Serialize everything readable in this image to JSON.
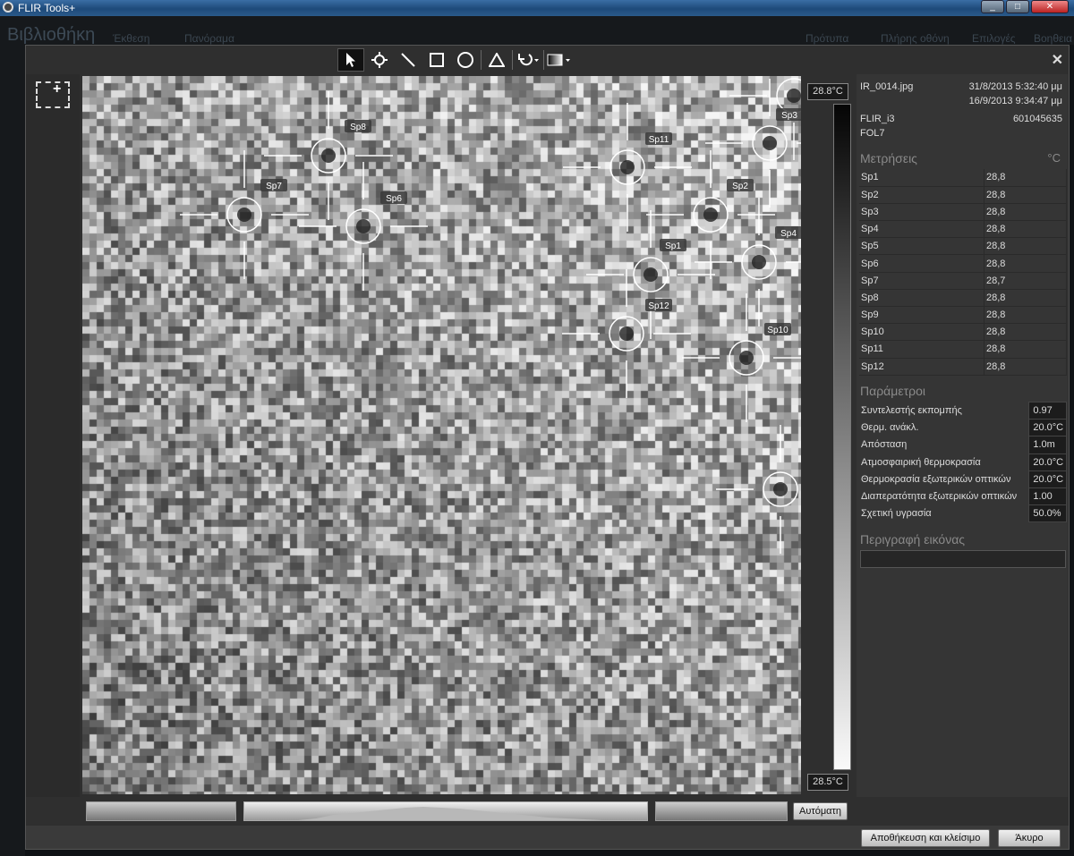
{
  "window": {
    "title": "FLIR Tools+"
  },
  "app_nav": {
    "library": "Βιβλιοθήκη",
    "items": [
      "Έκθεση",
      "Πανόραμα"
    ],
    "right_items": [
      "Πρότυπα",
      "Πλήρης οθόνη",
      "Επιλογές",
      "Βοηθεια"
    ]
  },
  "toolbar": {
    "tools": [
      {
        "name": "select-tool",
        "icon": "arrow-pointer-icon"
      },
      {
        "name": "spot-tool",
        "icon": "crosshair-icon"
      },
      {
        "name": "line-tool",
        "icon": "line-icon"
      },
      {
        "name": "box-tool",
        "icon": "square-icon"
      },
      {
        "name": "circle-tool",
        "icon": "circle-icon"
      },
      {
        "name": "delta-tool",
        "icon": "delta-icon"
      },
      {
        "name": "rotate-tool",
        "icon": "rotate-icon"
      },
      {
        "name": "palette-tool",
        "icon": "palette-icon"
      }
    ]
  },
  "spots": [
    {
      "label": "Sp1"
    },
    {
      "label": "Sp2"
    },
    {
      "label": "Sp3"
    },
    {
      "label": "Sp4"
    },
    {
      "label": "Sp5"
    },
    {
      "label": "Sp6"
    },
    {
      "label": "Sp7"
    },
    {
      "label": "Sp8"
    },
    {
      "label": "Sp9"
    },
    {
      "label": "Sp10"
    },
    {
      "label": "Sp11"
    },
    {
      "label": "Sp12"
    }
  ],
  "scale": {
    "max": "28.8°C",
    "min": "28.5°C"
  },
  "histogram": {
    "auto_button": "Αυτόματη"
  },
  "info": {
    "filename": "IR_0014.jpg",
    "date1": "31/8/2013 5:32:40 μμ",
    "date2": "16/9/2013 9:34:47 μμ",
    "camera": "FLIR_i3",
    "serial": "601045635",
    "lens": "FOL7"
  },
  "measurements": {
    "title": "Μετρήσεις",
    "unit": "°C",
    "rows": [
      {
        "name": "Sp1",
        "value": "28,8"
      },
      {
        "name": "Sp2",
        "value": "28,8"
      },
      {
        "name": "Sp3",
        "value": "28,8"
      },
      {
        "name": "Sp4",
        "value": "28,8"
      },
      {
        "name": "Sp5",
        "value": "28,8"
      },
      {
        "name": "Sp6",
        "value": "28,8"
      },
      {
        "name": "Sp7",
        "value": "28,7"
      },
      {
        "name": "Sp8",
        "value": "28,8"
      },
      {
        "name": "Sp9",
        "value": "28,8"
      },
      {
        "name": "Sp10",
        "value": "28,8"
      },
      {
        "name": "Sp11",
        "value": "28,8"
      },
      {
        "name": "Sp12",
        "value": "28,8"
      }
    ]
  },
  "parameters": {
    "title": "Παράμετροι",
    "rows": [
      {
        "name": "Συντελεστής εκπομπής",
        "value": "0.97"
      },
      {
        "name": "Θερμ. ανάκλ.",
        "value": "20.0°C"
      },
      {
        "name": "Απόσταση",
        "value": "1.0m"
      },
      {
        "name": "Ατμοσφαιρική θερμοκρασία",
        "value": "20.0°C"
      },
      {
        "name": "Θερμοκρασία εξωτερικών οπτικών",
        "value": "20.0°C"
      },
      {
        "name": "Διαπερατότητα εξωτερικών οπτικών",
        "value": "1.00"
      },
      {
        "name": "Σχετική υγρασία",
        "value": "50.0%"
      }
    ]
  },
  "description": {
    "title": "Περιγραφή εικόνας",
    "value": ""
  },
  "footer": {
    "save_close": "Αποθήκευση και κλείσιμο",
    "cancel": "Άκυρο"
  }
}
